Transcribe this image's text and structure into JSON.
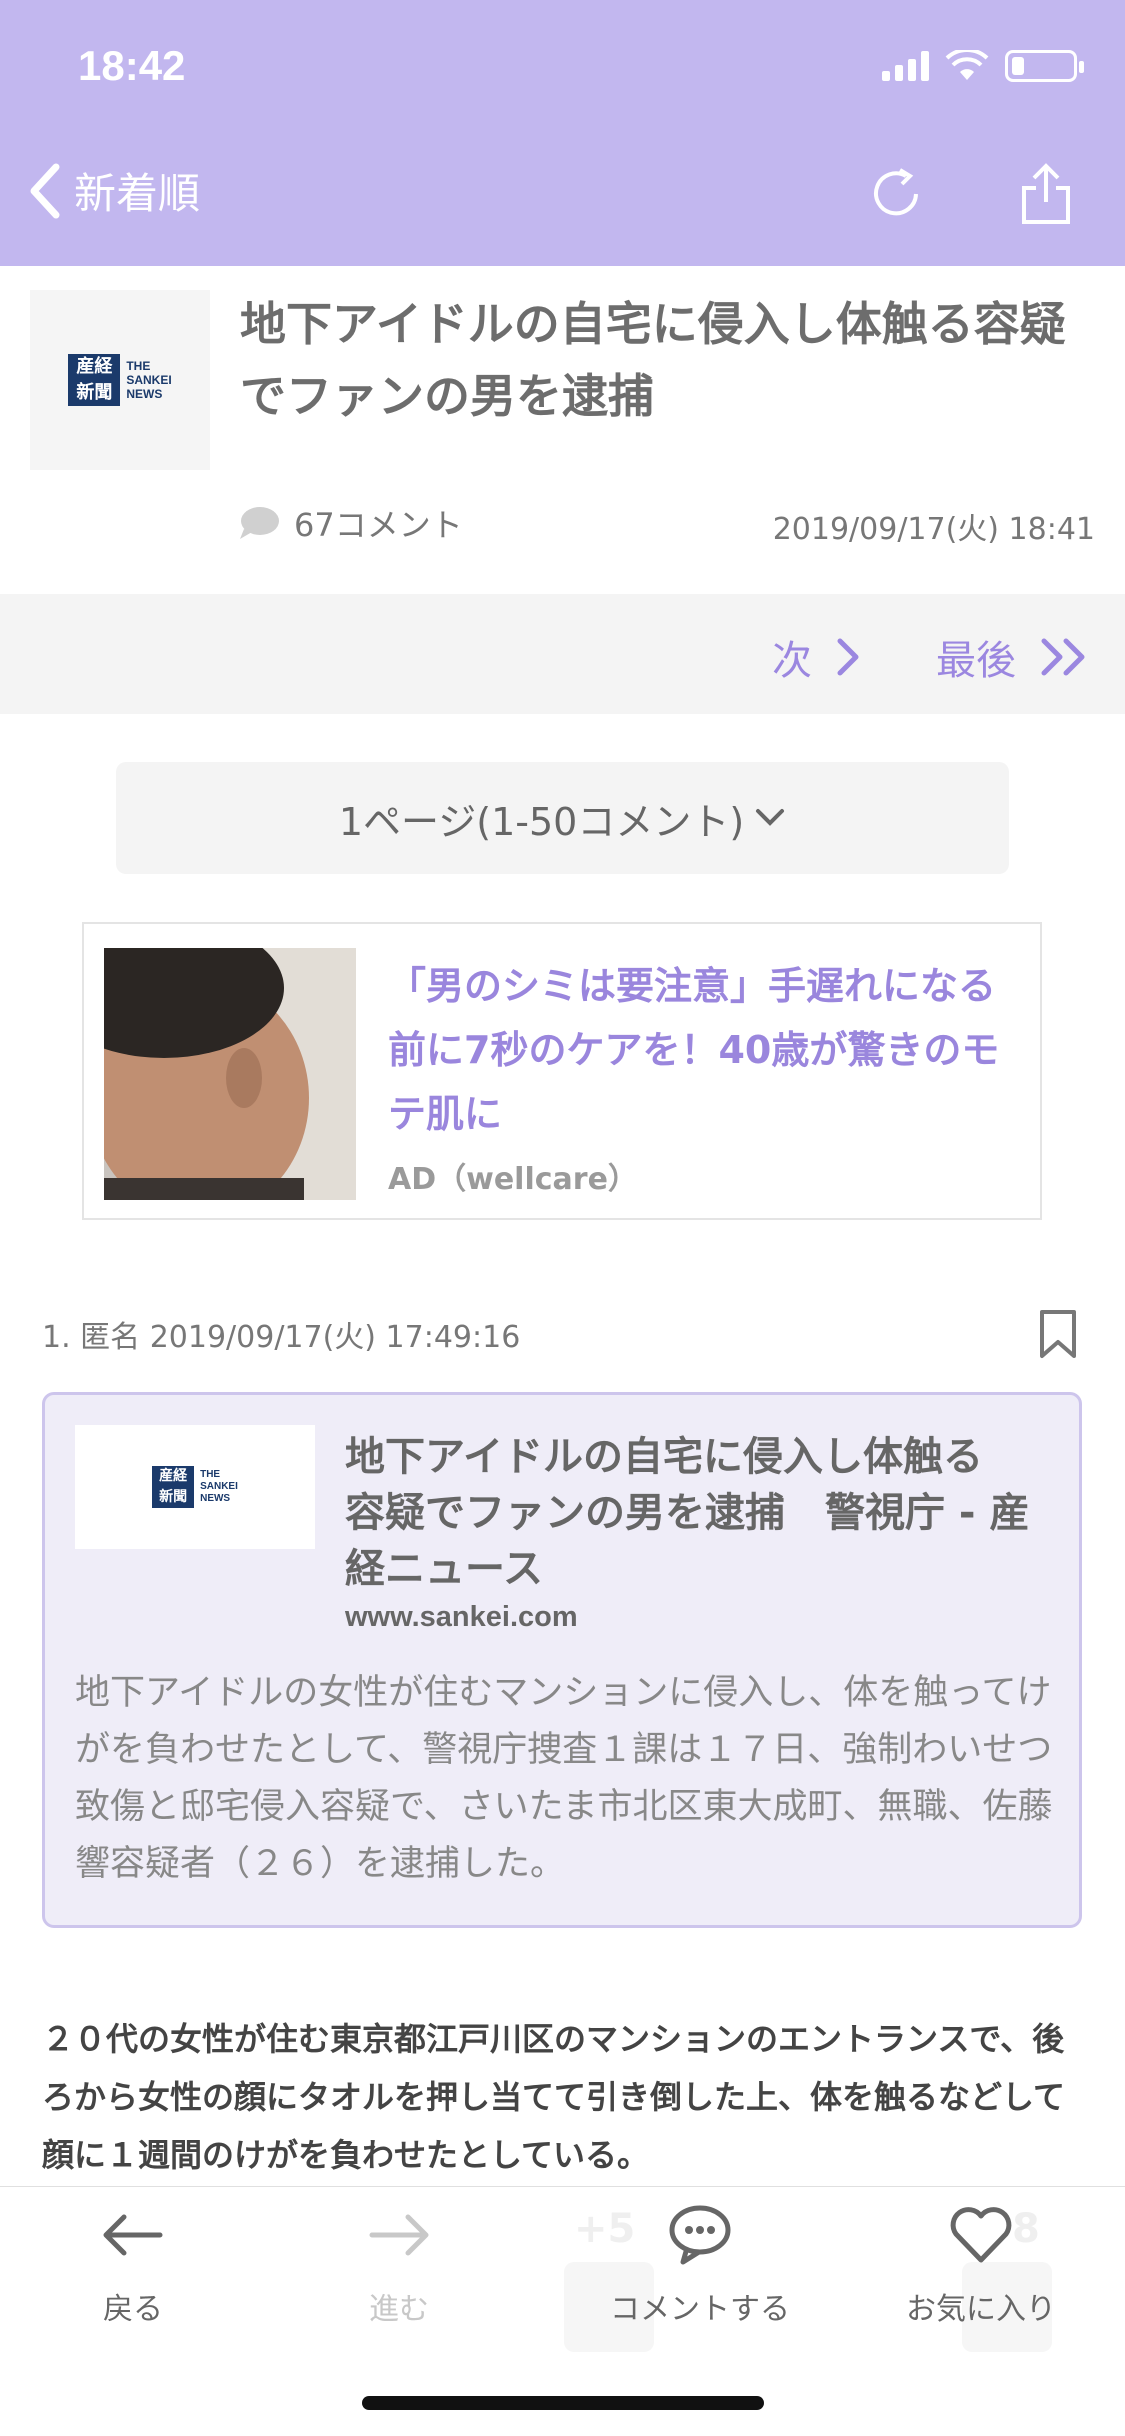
{
  "status_bar": {
    "time": "18:42"
  },
  "header": {
    "back_label": "新着順",
    "bg_color": "#c2b7ef",
    "icons": [
      "refresh-icon",
      "share-icon"
    ]
  },
  "article": {
    "title": "地下アイドルの自宅に侵入し体触る容疑でファンの男を逮捕",
    "comments": "67コメント",
    "date": "2019/09/17(火) 18:41",
    "source_logo": {
      "kanji": "産経\n新聞",
      "latin": "THE\nSANKEI\nNEWS"
    }
  },
  "pager": {
    "next": "次",
    "last": "最後",
    "accent": "#9b87e0"
  },
  "page_select": {
    "label": "1ページ(1-50コメント)"
  },
  "ad": {
    "title": "「男のシミは要注意」手遅れになる前に7秒のケアを！40歳が驚きのモテ肌に",
    "label": "AD（wellcare）"
  },
  "comment": {
    "meta": "1. 匿名 2019/09/17(火) 17:49:16",
    "link_card": {
      "title": "地下アイドルの自宅に侵入し体触る　容疑でファンの男を逮捕　警視庁 - 産経ニュース",
      "domain": "www.sankei.com",
      "description": "地下アイドルの女性が住むマンションに侵入し、体を触ってけがを負わせたとして、警視庁捜査１課は１７日、強制わいせつ致傷と邸宅侵入容疑で、さいたま市北区東大成町、無職、佐藤響容疑者（２６）を逮捕した。"
    },
    "body": "２０代の女性が住む東京都江戸川区のマンションのエントランスで、後ろから女性の顔にタオルを押し当てて引き倒した上、体を触るなどして顔に１週間のけがを負わせたとしている。",
    "hidden_votes": {
      "plus": "+5",
      "minus": "8"
    }
  },
  "toolbar": {
    "back": "戻る",
    "forward": "進む",
    "comment": "コメントする",
    "favorite": "お気に入り"
  }
}
